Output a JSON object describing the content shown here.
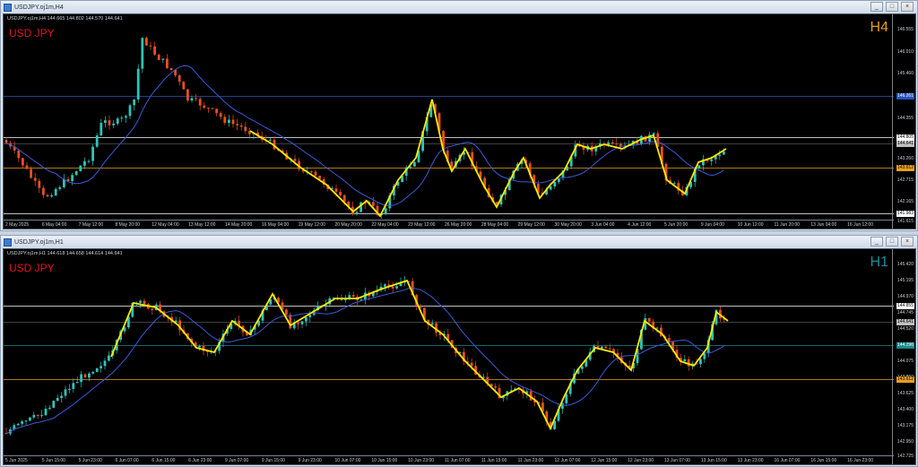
{
  "windows": [
    {
      "title": "USDJPY.oj1m,H4",
      "info": "USDJPY.oj1m,H4 144.665 144.802 144.570 144.641",
      "symbol": "USD JPY",
      "timeframe": "H4",
      "tf_color": "#e0a020",
      "price_ticks": [
        "146.555",
        "146.010",
        "145.460",
        "144.905",
        "144.355",
        "143.805",
        "143.260",
        "142.715",
        "142.165",
        "141.615"
      ],
      "price_tags": [
        {
          "label": "146.261",
          "color": "#2a54b8",
          "text": "#ffffff"
        },
        {
          "label": "144.805",
          "color": "#ffffff",
          "text": "#000000"
        },
        {
          "label": "144.641",
          "color": "#c0c0c0",
          "text": "#000000"
        },
        {
          "label": "143.612",
          "color": "#e8a020",
          "text": "#000000"
        },
        {
          "label": "141.983",
          "color": "#ffffff",
          "text": "#000000"
        }
      ],
      "time_ticks": [
        "2 May 2025",
        "6 May 04:00",
        "7 May 12:00",
        "8 May 20:00",
        "12 May 04:00",
        "13 May 12:00",
        "14 May 20:00",
        "16 May 04:00",
        "19 May 12:00",
        "20 May 20:00",
        "22 May 04:00",
        "23 May 12:00",
        "26 May 20:00",
        "28 May 04:00",
        "29 May 12:00",
        "30 May 20:00",
        "3 Jun 04:00",
        "4 Jun 12:00",
        "5 Jun 20:00",
        "9 Jun 04:00",
        "10 Jun 12:00",
        "11 Jun 20:00",
        "13 Jun 04:00",
        "16 Jun 12:00"
      ],
      "buttons": [
        "_",
        "□",
        "×"
      ]
    },
    {
      "title": "USDJPY.oj1m,H1",
      "info": "USDJPY.oj1m,H1 144.618 144.658 144.614 144.641",
      "symbol": "USD JPY",
      "timeframe": "H1",
      "tf_color": "#1a8fa0",
      "price_ticks": [
        "145.420",
        "145.195",
        "144.970",
        "144.745",
        "144.520",
        "144.300",
        "144.075",
        "143.850",
        "143.625",
        "143.400",
        "143.175",
        "142.950",
        "142.725"
      ],
      "price_tags": [
        {
          "label": "144.855",
          "color": "#ffffff",
          "text": "#000000"
        },
        {
          "label": "144.641",
          "color": "#c0c0c0",
          "text": "#000000"
        },
        {
          "label": "144.296",
          "color": "#1a8a8a",
          "text": "#ffffff"
        },
        {
          "label": "143.612",
          "color": "#e8a020",
          "text": "#000000"
        }
      ],
      "time_ticks": [
        "5 Jun 2025",
        "5 Jun 15:00",
        "5 Jun 23:00",
        "6 Jun 07:00",
        "6 Jun 15:00",
        "6 Jun 23:00",
        "9 Jun 07:00",
        "9 Jun 15:00",
        "9 Jun 23:00",
        "10 Jun 07:00",
        "10 Jun 15:00",
        "10 Jun 23:00",
        "11 Jun 07:00",
        "11 Jun 15:00",
        "11 Jun 23:00",
        "12 Jun 07:00",
        "12 Jun 15:00",
        "12 Jun 23:00",
        "13 Jun 07:00",
        "13 Jun 15:00",
        "13 Jun 23:00",
        "16 Jun 07:00",
        "16 Jun 15:00",
        "16 Jun 23:00"
      ],
      "buttons": [
        "_",
        "□",
        "×"
      ]
    }
  ],
  "colors": {
    "bull": "#2ec4b6",
    "bear": "#e8501e",
    "ma": "#3c5ad8",
    "zigzag": "#ffea00",
    "bg": "#000000"
  }
}
